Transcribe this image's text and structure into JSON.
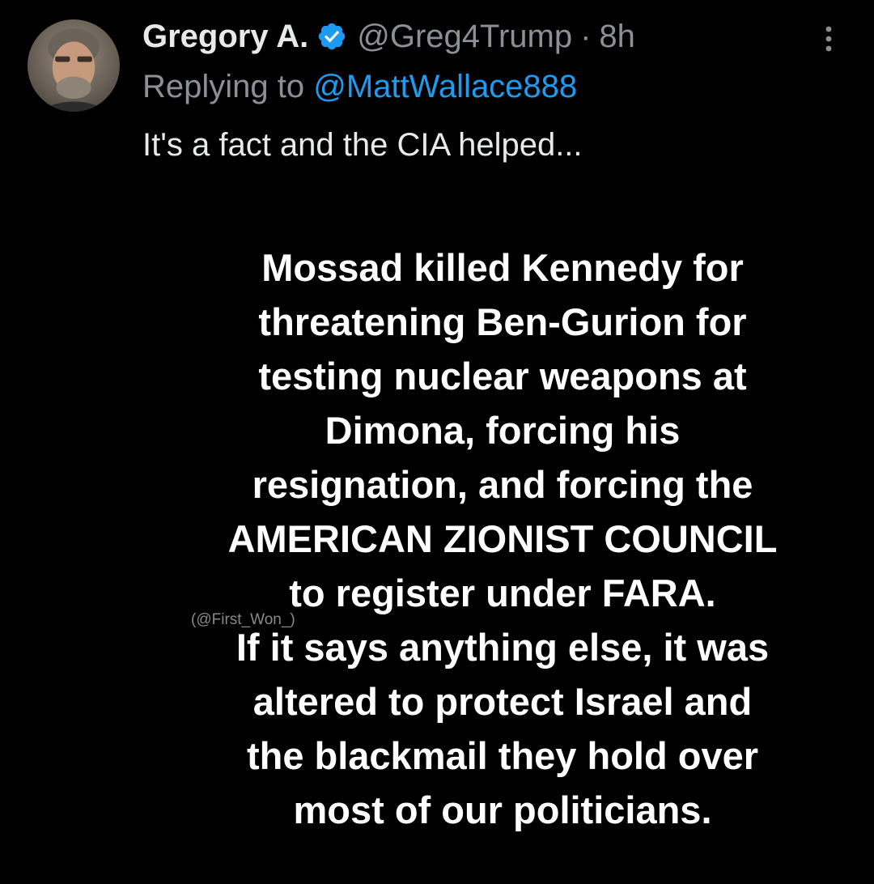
{
  "tweet": {
    "display_name": "Gregory A.",
    "verified_icon": "verified-badge-icon",
    "handle": "@Greg4Trump",
    "separator": "·",
    "timestamp": "8h",
    "reply_prefix": "Replying to",
    "reply_mention": "@MattWallace888",
    "text": "It's a fact and the CIA helped...",
    "more_icon": "more-vertical-icon"
  },
  "meme": {
    "lines": [
      "Mossad killed Kennedy for",
      "threatening Ben-Gurion for",
      "testing nuclear weapons at",
      "Dimona, forcing his",
      "resignation, and forcing the",
      "AMERICAN ZIONIST COUNCIL",
      "to register under FARA.",
      "If it says anything else, it was",
      "altered to protect Israel and",
      "the blackmail they hold over",
      "most of our politicians."
    ],
    "watermark": "(@First_Won_)"
  },
  "colors": {
    "background": "#000000",
    "primary_text": "#e7e9ea",
    "secondary_text": "#8b9096",
    "link": "#1d9bf0",
    "verified": "#1d9bf0"
  }
}
